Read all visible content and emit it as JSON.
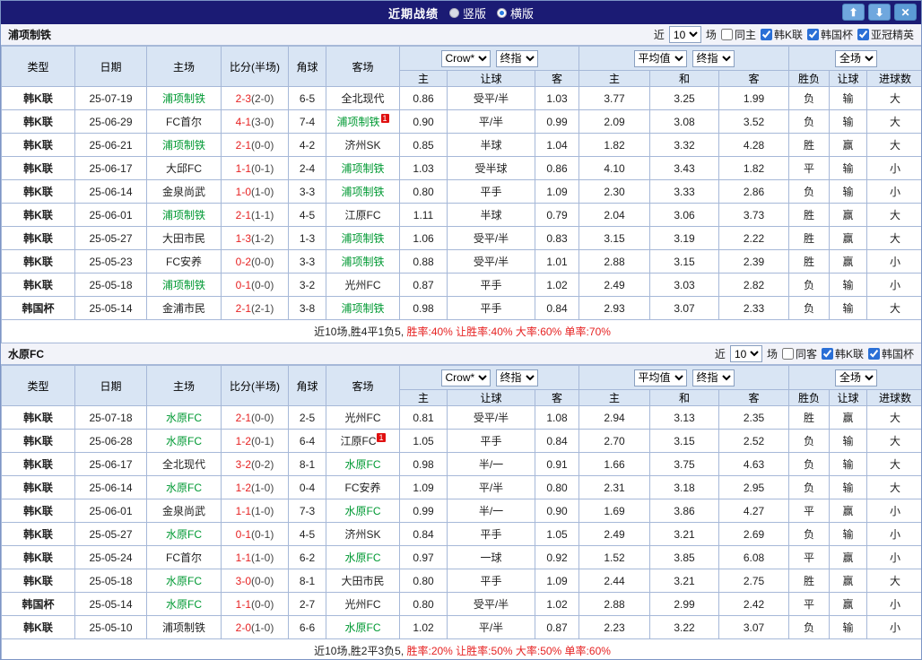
{
  "titlebar": {
    "title": "近期战绩",
    "options": [
      {
        "label": "竖版",
        "selected": false
      },
      {
        "label": "横版",
        "selected": true
      }
    ],
    "up_icon": "⬆",
    "down_icon": "⬇",
    "close_icon": "✕"
  },
  "colors": {
    "league_blue": "#2255cc",
    "cup_purple": "#5c2d91",
    "win_red": "#e62222",
    "lose_blue": "#2a5cd6",
    "draw_green": "#17a117",
    "focus_team_green": "#009933",
    "titlebar_navy": "#1b1b74"
  },
  "tables": [
    {
      "team": "浦项制铁",
      "filter": {
        "near_label": "近",
        "count": "10",
        "games_label": "场",
        "checkboxes": [
          {
            "label": "同主",
            "checked": false
          },
          {
            "label": "韩K联",
            "checked": true
          },
          {
            "label": "韩国杯",
            "checked": true
          },
          {
            "label": "亚冠精英",
            "checked": true
          }
        ]
      },
      "header": {
        "cols": [
          "类型",
          "日期",
          "主场",
          "比分(半场)",
          "角球",
          "客场"
        ],
        "group1": [
          "Crow*",
          "终指"
        ],
        "group2": [
          "平均值",
          "终指"
        ],
        "group3": [
          "全场"
        ],
        "sub": [
          "主",
          "让球",
          "客",
          "主",
          "和",
          "客",
          "胜负",
          "让球",
          "进球数"
        ]
      },
      "rows": [
        {
          "league": "韩K联",
          "league_cup": false,
          "date": "25-07-19",
          "home": "浦项制铁",
          "home_focus": true,
          "score": "2-3",
          "half": "(2-0)",
          "corner": "6-5",
          "away": "全北现代",
          "away_focus": false,
          "asian": [
            "0.86",
            "受平/半",
            "1.03"
          ],
          "euro": [
            "3.77",
            "3.25",
            "1.99"
          ],
          "results": [
            "负",
            "输",
            "大"
          ]
        },
        {
          "league": "韩K联",
          "league_cup": false,
          "date": "25-06-29",
          "home": "FC首尔",
          "home_focus": false,
          "score": "4-1",
          "half": "(3-0)",
          "corner": "7-4",
          "away": "浦项制铁",
          "away_focus": true,
          "away_badge": "1",
          "asian": [
            "0.90",
            "平/半",
            "0.99"
          ],
          "euro": [
            "2.09",
            "3.08",
            "3.52"
          ],
          "results": [
            "负",
            "输",
            "大"
          ]
        },
        {
          "league": "韩K联",
          "league_cup": false,
          "date": "25-06-21",
          "home": "浦项制铁",
          "home_focus": true,
          "score": "2-1",
          "half": "(0-0)",
          "corner": "4-2",
          "away": "济州SK",
          "away_focus": false,
          "asian": [
            "0.85",
            "半球",
            "1.04"
          ],
          "euro": [
            "1.82",
            "3.32",
            "4.28"
          ],
          "results": [
            "胜",
            "赢",
            "大"
          ]
        },
        {
          "league": "韩K联",
          "league_cup": false,
          "date": "25-06-17",
          "home": "大邱FC",
          "home_focus": false,
          "score": "1-1",
          "half": "(0-1)",
          "corner": "2-4",
          "away": "浦项制铁",
          "away_focus": true,
          "asian": [
            "1.03",
            "受半球",
            "0.86"
          ],
          "euro": [
            "4.10",
            "3.43",
            "1.82"
          ],
          "results": [
            "平",
            "输",
            "小"
          ]
        },
        {
          "league": "韩K联",
          "league_cup": false,
          "date": "25-06-14",
          "home": "金泉尚武",
          "home_focus": false,
          "score": "1-0",
          "half": "(1-0)",
          "corner": "3-3",
          "away": "浦项制铁",
          "away_focus": true,
          "asian": [
            "0.80",
            "平手",
            "1.09"
          ],
          "euro": [
            "2.30",
            "3.33",
            "2.86"
          ],
          "results": [
            "负",
            "输",
            "小"
          ]
        },
        {
          "league": "韩K联",
          "league_cup": false,
          "date": "25-06-01",
          "home": "浦项制铁",
          "home_focus": true,
          "score": "2-1",
          "half": "(1-1)",
          "corner": "4-5",
          "away": "江原FC",
          "away_focus": false,
          "asian": [
            "1.11",
            "半球",
            "0.79"
          ],
          "euro": [
            "2.04",
            "3.06",
            "3.73"
          ],
          "results": [
            "胜",
            "赢",
            "大"
          ]
        },
        {
          "league": "韩K联",
          "league_cup": false,
          "date": "25-05-27",
          "home": "大田市民",
          "home_focus": false,
          "score": "1-3",
          "half": "(1-2)",
          "corner": "1-3",
          "away": "浦项制铁",
          "away_focus": true,
          "asian": [
            "1.06",
            "受平/半",
            "0.83"
          ],
          "euro": [
            "3.15",
            "3.19",
            "2.22"
          ],
          "results": [
            "胜",
            "赢",
            "大"
          ]
        },
        {
          "league": "韩K联",
          "league_cup": false,
          "date": "25-05-23",
          "home": "FC安养",
          "home_focus": false,
          "score": "0-2",
          "half": "(0-0)",
          "corner": "3-3",
          "away": "浦项制铁",
          "away_focus": true,
          "asian": [
            "0.88",
            "受平/半",
            "1.01"
          ],
          "euro": [
            "2.88",
            "3.15",
            "2.39"
          ],
          "results": [
            "胜",
            "赢",
            "小"
          ]
        },
        {
          "league": "韩K联",
          "league_cup": false,
          "date": "25-05-18",
          "home": "浦项制铁",
          "home_focus": true,
          "score": "0-1",
          "half": "(0-0)",
          "corner": "3-2",
          "away": "光州FC",
          "away_focus": false,
          "asian": [
            "0.87",
            "平手",
            "1.02"
          ],
          "euro": [
            "2.49",
            "3.03",
            "2.82"
          ],
          "results": [
            "负",
            "输",
            "小"
          ]
        },
        {
          "league": "韩国杯",
          "league_cup": true,
          "date": "25-05-14",
          "home": "金浦市民",
          "home_focus": false,
          "score": "2-1",
          "half": "(2-1)",
          "corner": "3-8",
          "away": "浦项制铁",
          "away_focus": true,
          "asian": [
            "0.98",
            "平手",
            "0.84"
          ],
          "euro": [
            "2.93",
            "3.07",
            "2.33"
          ],
          "results": [
            "负",
            "输",
            "大"
          ]
        }
      ],
      "summary": {
        "prefix": "近10场,胜4平1负5, ",
        "stats": "胜率:40% 让胜率:40% 大率:60% 单率:70%"
      }
    },
    {
      "team": "水原FC",
      "filter": {
        "near_label": "近",
        "count": "10",
        "games_label": "场",
        "checkboxes": [
          {
            "label": "同客",
            "checked": false
          },
          {
            "label": "韩K联",
            "checked": true
          },
          {
            "label": "韩国杯",
            "checked": true
          }
        ]
      },
      "header": {
        "cols": [
          "类型",
          "日期",
          "主场",
          "比分(半场)",
          "角球",
          "客场"
        ],
        "group1": [
          "Crow*",
          "终指"
        ],
        "group2": [
          "平均值",
          "终指"
        ],
        "group3": [
          "全场"
        ],
        "sub": [
          "主",
          "让球",
          "客",
          "主",
          "和",
          "客",
          "胜负",
          "让球",
          "进球数"
        ]
      },
      "rows": [
        {
          "league": "韩K联",
          "league_cup": false,
          "date": "25-07-18",
          "home": "水原FC",
          "home_focus": true,
          "score": "2-1",
          "half": "(0-0)",
          "corner": "2-5",
          "away": "光州FC",
          "away_focus": false,
          "asian": [
            "0.81",
            "受平/半",
            "1.08"
          ],
          "euro": [
            "2.94",
            "3.13",
            "2.35"
          ],
          "results": [
            "胜",
            "赢",
            "大"
          ]
        },
        {
          "league": "韩K联",
          "league_cup": false,
          "date": "25-06-28",
          "home": "水原FC",
          "home_focus": true,
          "score": "1-2",
          "half": "(0-1)",
          "corner": "6-4",
          "away": "江原FC",
          "away_focus": false,
          "away_badge": "1",
          "asian": [
            "1.05",
            "平手",
            "0.84"
          ],
          "euro": [
            "2.70",
            "3.15",
            "2.52"
          ],
          "results": [
            "负",
            "输",
            "大"
          ]
        },
        {
          "league": "韩K联",
          "league_cup": false,
          "date": "25-06-17",
          "home": "全北现代",
          "home_focus": false,
          "score": "3-2",
          "half": "(0-2)",
          "corner": "8-1",
          "away": "水原FC",
          "away_focus": true,
          "asian": [
            "0.98",
            "半/一",
            "0.91"
          ],
          "euro": [
            "1.66",
            "3.75",
            "4.63"
          ],
          "results": [
            "负",
            "输",
            "大"
          ]
        },
        {
          "league": "韩K联",
          "league_cup": false,
          "date": "25-06-14",
          "home": "水原FC",
          "home_focus": true,
          "score": "1-2",
          "half": "(1-0)",
          "corner": "0-4",
          "away": "FC安养",
          "away_focus": false,
          "asian": [
            "1.09",
            "平/半",
            "0.80"
          ],
          "euro": [
            "2.31",
            "3.18",
            "2.95"
          ],
          "results": [
            "负",
            "输",
            "大"
          ]
        },
        {
          "league": "韩K联",
          "league_cup": false,
          "date": "25-06-01",
          "home": "金泉尚武",
          "home_focus": false,
          "score": "1-1",
          "half": "(1-0)",
          "corner": "7-3",
          "away": "水原FC",
          "away_focus": true,
          "asian": [
            "0.99",
            "半/一",
            "0.90"
          ],
          "euro": [
            "1.69",
            "3.86",
            "4.27"
          ],
          "results": [
            "平",
            "赢",
            "小"
          ]
        },
        {
          "league": "韩K联",
          "league_cup": false,
          "date": "25-05-27",
          "home": "水原FC",
          "home_focus": true,
          "score": "0-1",
          "half": "(0-1)",
          "corner": "4-5",
          "away": "济州SK",
          "away_focus": false,
          "asian": [
            "0.84",
            "平手",
            "1.05"
          ],
          "euro": [
            "2.49",
            "3.21",
            "2.69"
          ],
          "results": [
            "负",
            "输",
            "小"
          ]
        },
        {
          "league": "韩K联",
          "league_cup": false,
          "date": "25-05-24",
          "home": "FC首尔",
          "home_focus": false,
          "score": "1-1",
          "half": "(1-0)",
          "corner": "6-2",
          "away": "水原FC",
          "away_focus": true,
          "asian": [
            "0.97",
            "一球",
            "0.92"
          ],
          "euro": [
            "1.52",
            "3.85",
            "6.08"
          ],
          "results": [
            "平",
            "赢",
            "小"
          ]
        },
        {
          "league": "韩K联",
          "league_cup": false,
          "date": "25-05-18",
          "home": "水原FC",
          "home_focus": true,
          "score": "3-0",
          "half": "(0-0)",
          "corner": "8-1",
          "away": "大田市民",
          "away_focus": false,
          "asian": [
            "0.80",
            "平手",
            "1.09"
          ],
          "euro": [
            "2.44",
            "3.21",
            "2.75"
          ],
          "results": [
            "胜",
            "赢",
            "大"
          ]
        },
        {
          "league": "韩国杯",
          "league_cup": true,
          "date": "25-05-14",
          "home": "水原FC",
          "home_focus": true,
          "score": "1-1",
          "half": "(0-0)",
          "corner": "2-7",
          "away": "光州FC",
          "away_focus": false,
          "asian": [
            "0.80",
            "受平/半",
            "1.02"
          ],
          "euro": [
            "2.88",
            "2.99",
            "2.42"
          ],
          "results": [
            "平",
            "赢",
            "小"
          ]
        },
        {
          "league": "韩K联",
          "league_cup": false,
          "date": "25-05-10",
          "home": "浦项制铁",
          "home_focus": false,
          "score": "2-0",
          "half": "(1-0)",
          "corner": "6-6",
          "away": "水原FC",
          "away_focus": true,
          "asian": [
            "1.02",
            "平/半",
            "0.87"
          ],
          "euro": [
            "2.23",
            "3.22",
            "3.07"
          ],
          "results": [
            "负",
            "输",
            "小"
          ]
        }
      ],
      "summary": {
        "prefix": "近10场,胜2平3负5, ",
        "stats": "胜率:20% 让胜率:50% 大率:50% 单率:60%"
      }
    }
  ]
}
